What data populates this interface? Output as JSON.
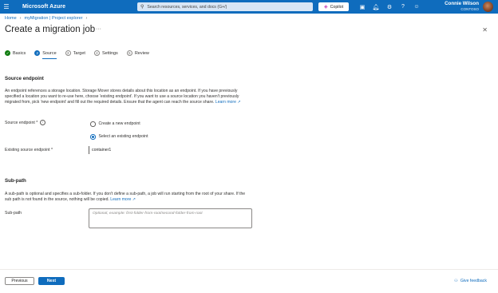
{
  "topbar": {
    "menu_icon": "waffle-icon",
    "brand": "Microsoft Azure",
    "search_placeholder": "Search resources, services, and docs (G+/)",
    "copilot_label": "Copilot",
    "icons": [
      "cloud-shell-icon",
      "notifications-icon",
      "settings-icon",
      "help-icon",
      "feedback-icon"
    ],
    "user_name": "Connie Wilson",
    "user_org": "CONTOSO"
  },
  "breadcrumb": [
    "Home",
    "myMigration | Project explorer"
  ],
  "page": {
    "title": "Create a migration job",
    "more": "···",
    "close": "✕"
  },
  "steps": [
    {
      "label": "Basics",
      "state": "done",
      "marker": "✓"
    },
    {
      "label": "Source",
      "state": "current",
      "marker": "2"
    },
    {
      "label": "Target",
      "state": "todo",
      "marker": "3"
    },
    {
      "label": "Settings",
      "state": "todo",
      "marker": "4"
    },
    {
      "label": "Review",
      "state": "todo",
      "marker": "5"
    }
  ],
  "source_endpoint": {
    "heading": "Source endpoint",
    "description": "An endpoint references a storage location. Storage Mover stores details about this location as an endpoint. If you have previously specified a location you want to re-use here, choose 'existing endpoint'. If you want to use a source location you haven't previously migrated from, pick 'new endpoint' and fill out the required details. Ensure that the agent can reach the source share.",
    "learn_more": "Learn more",
    "field_label": "Source endpoint *",
    "options": [
      "Create a new endpoint",
      "Select an existing endpoint"
    ],
    "selected_index": 1,
    "existing_label": "Existing source endpoint *",
    "existing_value": "container1"
  },
  "sub_path": {
    "heading": "Sub-path",
    "description": "A sub-path is optional and specifies a sub-folder. If you don't define a sub-path, a job will run starting from the root of your share. If the sub path is not found in the source, nothing will be copied.",
    "learn_more": "Learn more",
    "field_label": "Sub-path",
    "placeholder": "Optional, example: first-folder-from-root/second-folder-from-root"
  },
  "footer": {
    "previous": "Previous",
    "next": "Next",
    "feedback": "Give feedback"
  },
  "colors": {
    "accent": "#0f6cbd",
    "done": "#107c10"
  }
}
